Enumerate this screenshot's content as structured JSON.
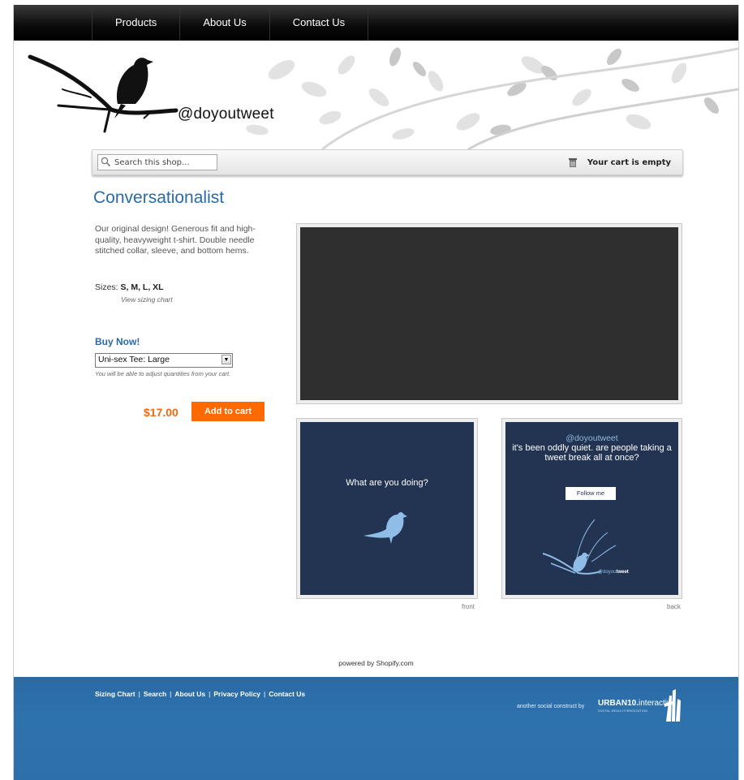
{
  "nav": {
    "items": [
      "Products",
      "About Us",
      "Contact Us"
    ]
  },
  "header": {
    "handle": "@doyoutweet"
  },
  "search": {
    "placeholder": "Search this shop..."
  },
  "cart": {
    "status": "Your cart is empty"
  },
  "product": {
    "title": "Conversationalist",
    "description": "Our original design! Generous fit and high-quality, heavyweight t-shirt. Double needle stitched collar, sleeve, and bottom hems.",
    "sizes_label": "Sizes:",
    "sizes_value": "S, M, L, XL",
    "sizing_link": "View sizing chart",
    "buy_title": "Buy Now!",
    "variant_selected": "Uni-sex Tee: Large",
    "qty_note": "You will be able to adjust quantities from your cart.",
    "price": "$17.00",
    "add_to_cart": "Add to cart"
  },
  "images": {
    "front": {
      "text": "What are you doing?",
      "caption": "front"
    },
    "back": {
      "handle": "@doyoutweet",
      "text": "it's been oddly quiet. are people taking a tweet break all at once?",
      "follow_label": "Follow me",
      "brand_prefix": "@doyou",
      "brand_suffix": "tweet",
      "caption": "back"
    }
  },
  "powered_by": "powered by Shopify.com",
  "footer": {
    "links": [
      "Sizing Chart",
      "Search",
      "About Us",
      "Privacy Policy",
      "Contact Us"
    ],
    "credit": "another social construct by",
    "logo_bold": "URBAN10.",
    "logo_thin": "interactive",
    "logo_tagline": "DIGITAL MEDIA HYBRIDIZATION"
  },
  "colors": {
    "accent": "#2a6aa5",
    "price": "#f26a10",
    "button": "#ff6a00",
    "shirt": "#223452",
    "footer": "#2d6fab"
  },
  "icons": {
    "search": "magnifier-icon",
    "cart": "cart-icon",
    "bird": "bird-icon",
    "footer_logo": "urban10-logo-icon"
  }
}
